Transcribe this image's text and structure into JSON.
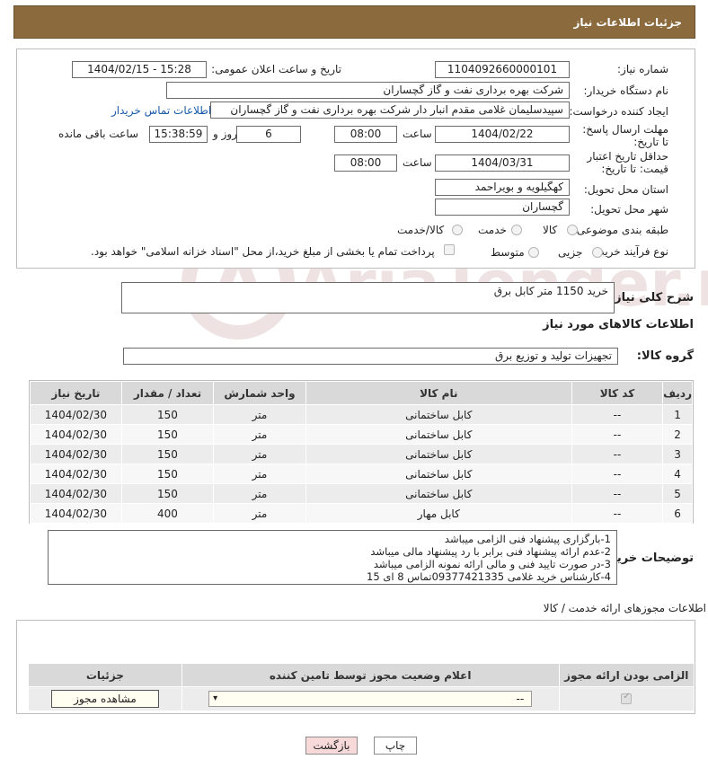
{
  "header": {
    "title": "جزئیات اطلاعات نیاز"
  },
  "form": {
    "need_number_label": "شماره نیاز:",
    "need_number": "1104092660000101",
    "announce_label": "تاریخ و ساعت اعلان عمومی:",
    "announce_value": "1404/02/15 - 15:28",
    "buyer_org_label": "نام دستگاه خریدار:",
    "buyer_org": "شرکت بهره برداری نفت و گاز گچساران",
    "creator_label": "ایجاد کننده درخواست:",
    "creator": "سپیدسلیمان غلامی مقدم انبار دار شرکت بهره برداری نفت و گاز گچساران",
    "contact_link": "اطلاعات تماس خریدار",
    "deadline_label": "مهلت ارسال پاسخ: تا تاریخ:",
    "deadline_date": "1404/02/22",
    "time_label": "ساعت",
    "deadline_time": "08:00",
    "days_value": "6",
    "days_label": "روز و",
    "remaining_time": "15:38:59",
    "remaining_label": "ساعت باقی مانده",
    "price_validity_label": "حداقل تاریخ اعتبار قیمت: تا تاریخ:",
    "price_date": "1404/03/31",
    "price_time": "08:00",
    "province_label": "استان محل تحویل:",
    "province": "کهگیلویه و بویراحمد",
    "city_label": "شهر محل تحویل:",
    "city": "گچساران",
    "category_label": "طبقه بندی موضوعی:",
    "category_options": [
      "کالا",
      "خدمت",
      "کالا/خدمت"
    ],
    "category_selected": "کالا",
    "process_label": "نوع فرآیند خرید :",
    "process_options": [
      "جزیی",
      "متوسط"
    ],
    "payment_note": "پرداخت تمام یا بخشی از مبلغ خرید،از محل \"اسناد خزانه اسلامی\" خواهد بود."
  },
  "summary": {
    "label": "شرح کلی نیاز:",
    "value": "خرید 1150 متر کابل برق"
  },
  "goods": {
    "section_title": "اطلاعات کالاهای مورد نیاز",
    "group_label": "گروه کالا:",
    "group_value": "تجهیزات تولید و توزیع برق",
    "columns": [
      "ردیف",
      "کد کالا",
      "نام کالا",
      "واحد شمارش",
      "تعداد / مقدار",
      "تاریخ نیاز"
    ],
    "rows": [
      [
        "1",
        "--",
        "کابل ساختمانی",
        "متر",
        "150",
        "1404/02/30"
      ],
      [
        "2",
        "--",
        "کابل ساختمانی",
        "متر",
        "150",
        "1404/02/30"
      ],
      [
        "3",
        "--",
        "کابل ساختمانی",
        "متر",
        "150",
        "1404/02/30"
      ],
      [
        "4",
        "--",
        "کابل ساختمانی",
        "متر",
        "150",
        "1404/02/30"
      ],
      [
        "5",
        "--",
        "کابل ساختمانی",
        "متر",
        "150",
        "1404/02/30"
      ],
      [
        "6",
        "--",
        "کابل مهار",
        "متر",
        "400",
        "1404/02/30"
      ]
    ]
  },
  "notes": {
    "label": "توضیحات خریدار:",
    "lines": [
      "1-بارگزاری پیشنهاد فنی الزامی میباشد",
      "2-عدم ارائه پیشنهاد فنی برابر با رد پیشنهاد مالی میباشد",
      "3-در صورت تایید فنی و مالی ارائه نمونه الزامی میباشد",
      "4-کارشناس خرید غلامی 09377421335تماس 8 ای 15"
    ]
  },
  "permits": {
    "section_title": "اطلاعات مجوزهای ارائه خدمت / کالا",
    "columns": [
      "الزامی بودن ارائه مجوز",
      "اعلام وضعیت مجوز توسط تامین کننده",
      "جزئیات"
    ],
    "select_value": "--",
    "view_button": "مشاهده مجوز"
  },
  "buttons": {
    "print": "چاپ",
    "back": "بازگشت"
  },
  "watermark": "AriaTender.neT"
}
